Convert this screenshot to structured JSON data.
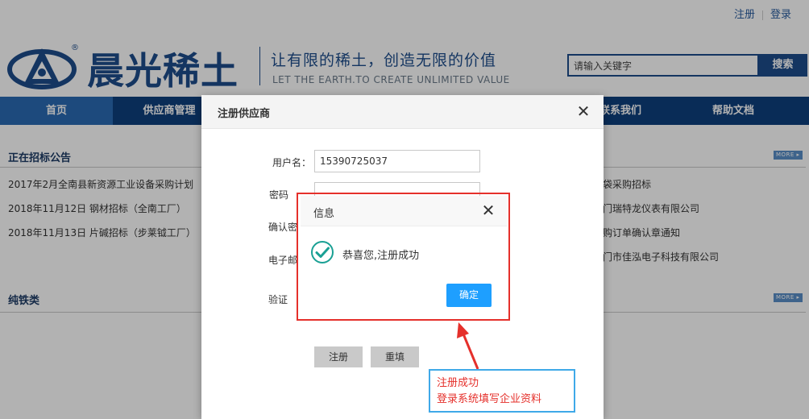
{
  "toplinks": {
    "register": "注册",
    "login": "登录"
  },
  "brand": {
    "name": "晨光稀土",
    "slogan_cn": "让有限的稀土，创造无限的价值",
    "slogan_en": "LET THE EARTH.TO CREATE UNLIMITED VALUE",
    "color": "#1d4d8c"
  },
  "search": {
    "placeholder": "请输入关键字",
    "button": "搜索"
  },
  "nav": {
    "items": [
      {
        "label": "首页",
        "active": true
      },
      {
        "label": "供应商管理",
        "active": false
      },
      {
        "label": "联系我们",
        "active": false
      },
      {
        "label": "帮助文档",
        "active": false
      }
    ]
  },
  "sections": {
    "bidding": {
      "title": "正在招标公告",
      "more": "MORE ▸",
      "left_items": [
        "2017年2月全南县新资源工业设备采购计划",
        "2018年11月12日 钢材招标（全南工厂）",
        "2018年11月13日 片碱招标（步莱钺工厂）"
      ],
      "right_items": [
        "袋采购招标",
        "门瑞特龙仪表有限公司",
        "购订单确认章通知",
        "厦门市佳泓电子科技有限公司"
      ]
    },
    "pure_iron": {
      "title": "纯铁类",
      "more": "MORE ▸"
    }
  },
  "register_dialog": {
    "title": "注册供应商",
    "fields": [
      {
        "label": "用户名：",
        "value": "15390725037"
      },
      {
        "label": "密码",
        "value": ""
      },
      {
        "label": "确认密",
        "value": ""
      },
      {
        "label": "电子邮",
        "value": ""
      },
      {
        "label": "验证",
        "value": ""
      }
    ],
    "buttons": {
      "submit": "注册",
      "reset": "重填"
    }
  },
  "info_dialog": {
    "title": "信息",
    "message": "恭喜您,注册成功",
    "confirm": "确定",
    "accent": "#1e9fff",
    "success_color": "#1aa094"
  },
  "annotation": {
    "lines": [
      "注册成功",
      "登录系统填写企业资料"
    ],
    "text_color": "#e5302b",
    "box_color": "#3fa9e8"
  }
}
